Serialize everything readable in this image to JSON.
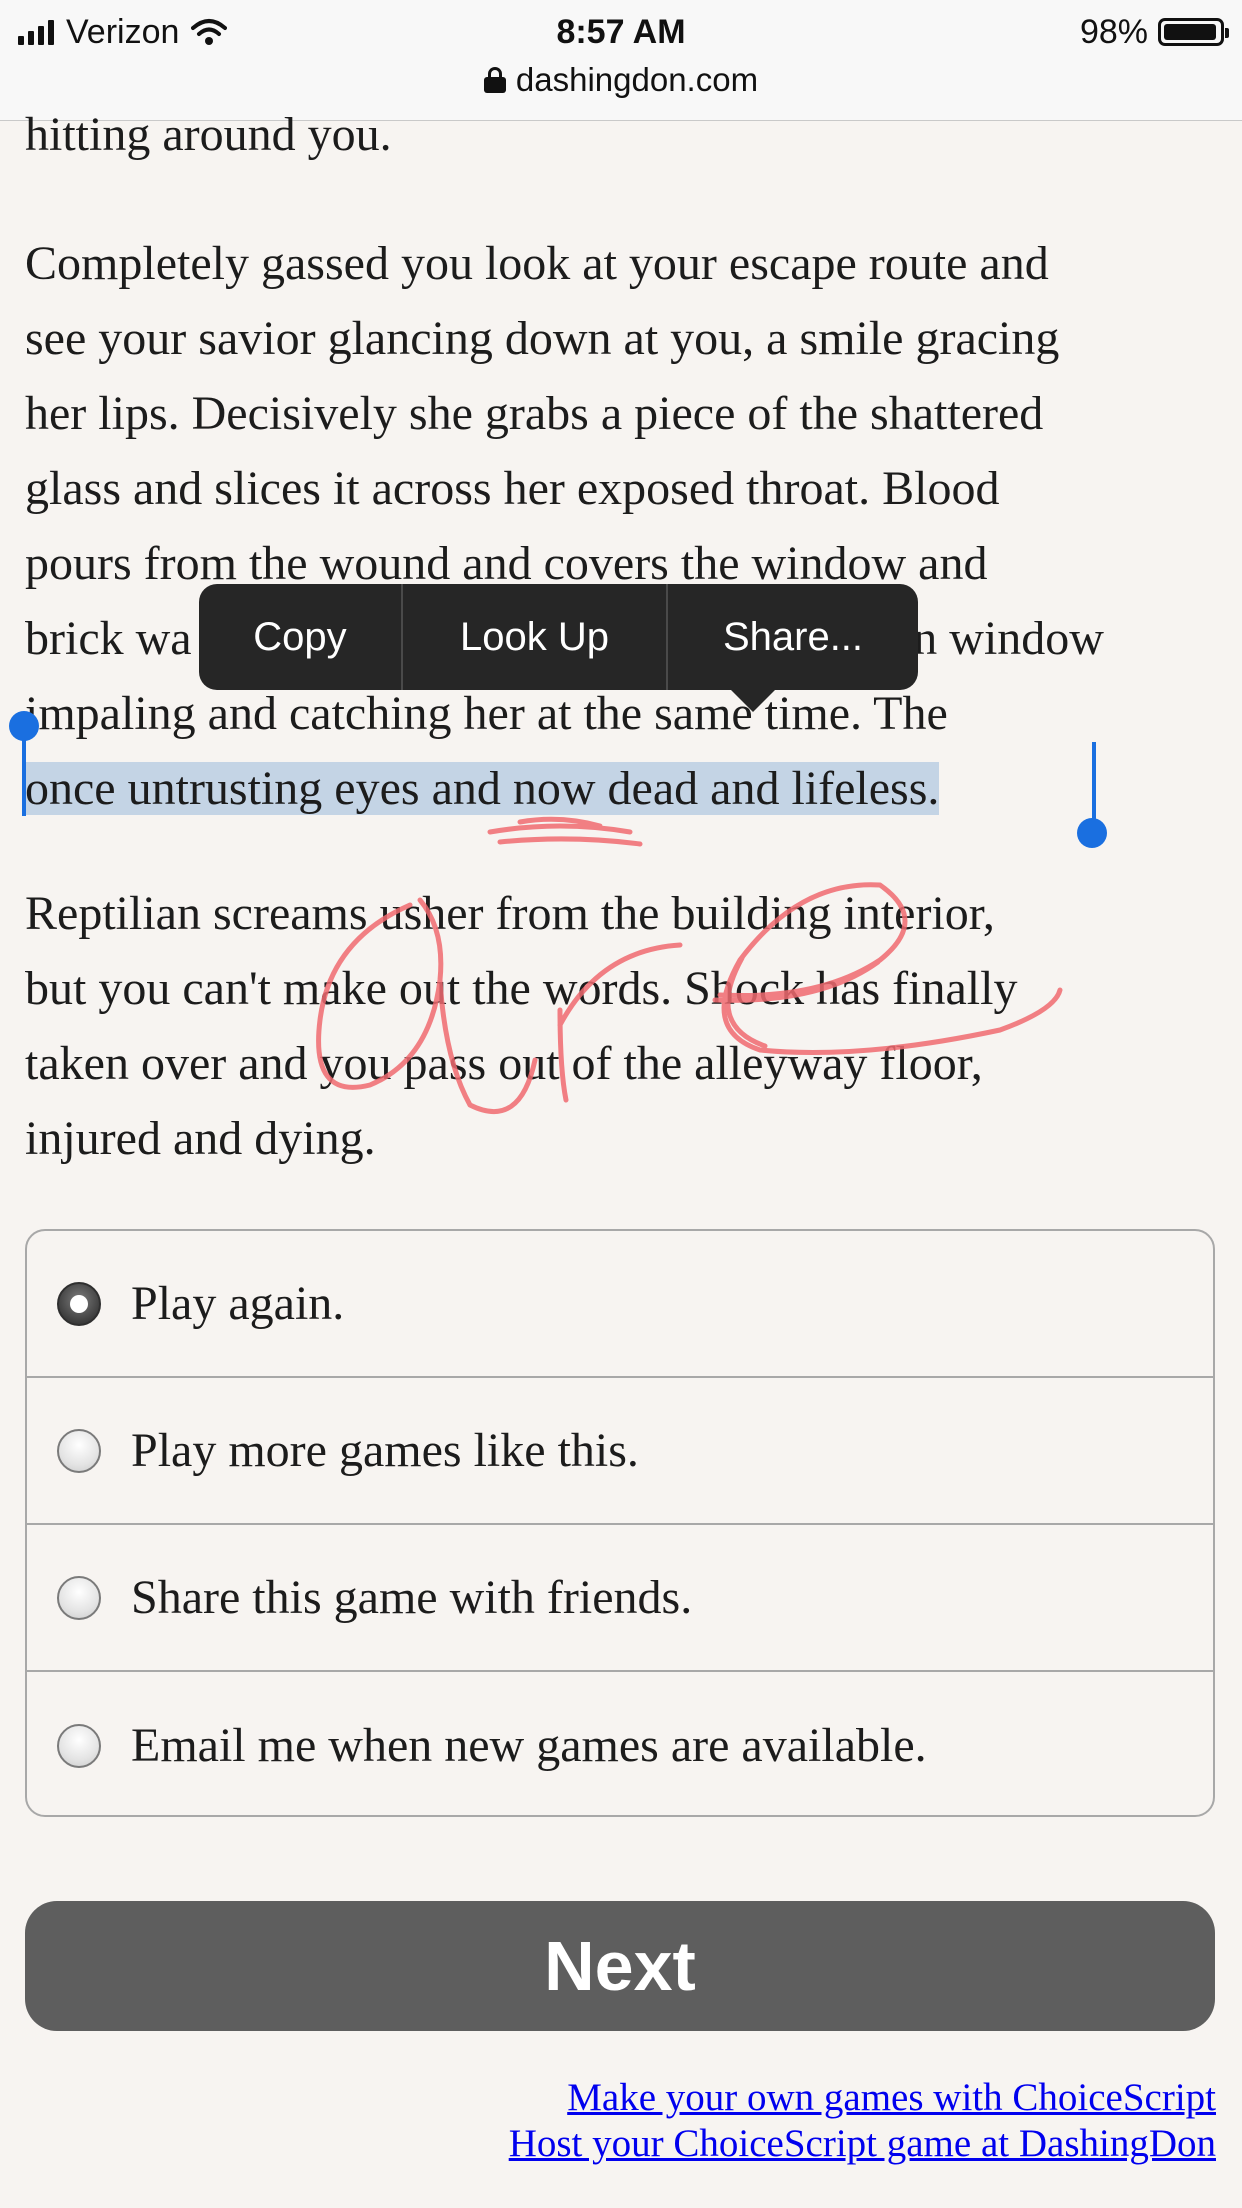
{
  "status_bar": {
    "carrier": "Verizon",
    "time": "8:57 AM",
    "battery": "98%",
    "url": "dashingdon.com",
    "battery_level": 0.98
  },
  "story": {
    "line_top": "hitting around you.",
    "p1_lines": [
      "Completely gassed you look at your escape route and",
      "see your savior glancing down at you, a smile gracing",
      "her lips. Decisively she grabs a piece of the shattered",
      "glass and slices it across her exposed throat. Blood",
      "pours from the wound and covers the window and",
      "brick wa",
      "en window",
      "impaling and catching her at the same time. The",
      "once untrusting eyes and now dead and lifeless."
    ],
    "p2_lines": [
      "Reptilian screams usher from the building interior,",
      "but you can't make out the words. Shock has finally",
      "taken over and you pass out of the alleyway floor,",
      "injured and dying."
    ]
  },
  "context_menu": {
    "copy": "Copy",
    "look_up": "Look Up",
    "share": "Share..."
  },
  "choices": [
    {
      "label": "Play again.",
      "checked": true
    },
    {
      "label": "Play more games like this.",
      "checked": false
    },
    {
      "label": "Share this game with friends.",
      "checked": false
    },
    {
      "label": "Email me when new games are available.",
      "checked": false
    }
  ],
  "next_button": "Next",
  "footer": {
    "link1": "Make your own games with ChoiceScript",
    "link2": "Host your ChoiceScript game at DashingDon"
  },
  "handwriting": "are",
  "colors": {
    "selection": "#c4d4e5",
    "selection_handle": "#1a6fe0",
    "doodle": "#f06a70",
    "next_button": "#5e5e5e",
    "link": "#0000ee"
  }
}
